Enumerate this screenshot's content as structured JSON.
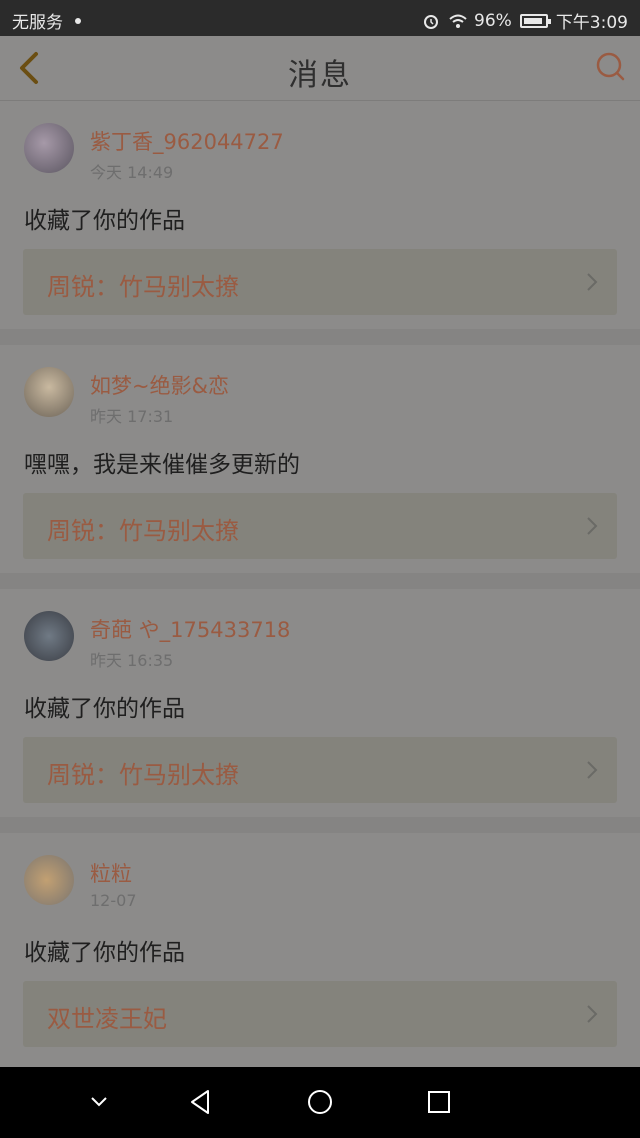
{
  "status_bar": {
    "carrier": "无服务",
    "battery": "96%",
    "time": "下午3:09"
  },
  "header": {
    "title": "消息",
    "back_icon": "back-chevron-icon",
    "search_icon": "search-icon"
  },
  "messages": [
    {
      "username": "紫丁香_962044727",
      "time": "今天  14:49",
      "text": "收藏了你的作品",
      "book": "周锐：竹马别太撩"
    },
    {
      "username": "如梦~绝影&恋",
      "time": "昨天  17:31",
      "text": "嘿嘿，我是来催催多更新的",
      "book": "周锐：竹马别太撩"
    },
    {
      "username": "奇葩 や_175433718",
      "time": "昨天  16:35",
      "text": "收藏了你的作品",
      "book": "周锐：竹马别太撩"
    },
    {
      "username": "粒粒",
      "time": "12-07",
      "text": "收藏了你的作品",
      "book": "双世凌王妃"
    }
  ],
  "colors": {
    "accent": "#9a5b42",
    "overlay_bg": "#8c8b8a"
  }
}
